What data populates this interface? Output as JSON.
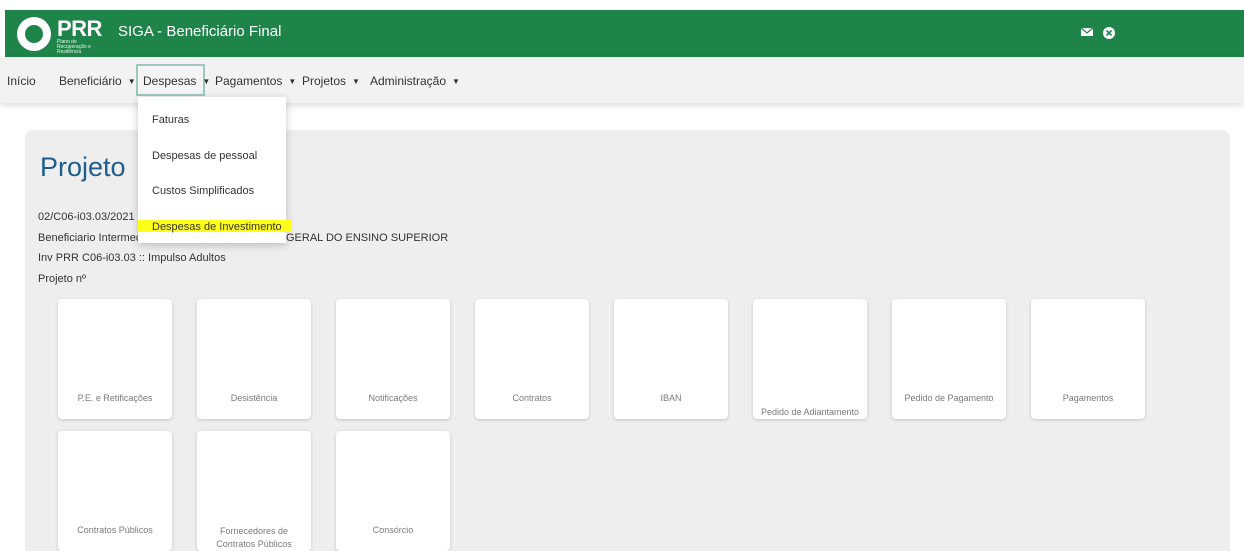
{
  "header": {
    "logo_text": "PRR",
    "logo_subtext": "Plano de Recuperação e Resiliência",
    "app_title": "SIGA - Beneficiário Final",
    "icons": [
      "mail-icon",
      "close-circle-icon"
    ],
    "brand_color": "#1e8449"
  },
  "navbar": {
    "items": [
      {
        "label": "Início",
        "has_dropdown": false
      },
      {
        "label": "Beneficiário",
        "has_dropdown": true
      },
      {
        "label": "Despesas",
        "has_dropdown": true,
        "active": true
      },
      {
        "label": "Pagamentos",
        "has_dropdown": true
      },
      {
        "label": "Projetos",
        "has_dropdown": true
      },
      {
        "label": "Administração",
        "has_dropdown": true
      }
    ],
    "caret": "▼"
  },
  "dropdown": {
    "items": [
      {
        "label": "Faturas"
      },
      {
        "label": "Despesas de pessoal"
      },
      {
        "label": "Custos Simplificados"
      },
      {
        "label": "Despesas de Investimento",
        "highlighted": true
      }
    ],
    "highlight_color": "#ffff1a"
  },
  "main": {
    "title": "Projeto",
    "info_lines": [
      "02/C06-i03.03/2021 :",
      "Beneficiario Intermec",
      "GERAL DO ENSINO SUPERIOR",
      "Inv PRR C06-i03.03 :: Impulso Adultos",
      "Projeto nº"
    ],
    "title_color": "#1f5d8c"
  },
  "cards": [
    {
      "label": "P.E. e Retificações"
    },
    {
      "label": "Desistência"
    },
    {
      "label": "Notificações"
    },
    {
      "label": "Contratos"
    },
    {
      "label": "IBAN"
    },
    {
      "label": "Pedido de Adiantamento"
    },
    {
      "label": "Pedido de Pagamento"
    },
    {
      "label": "Pagamentos"
    },
    {
      "label": "Contratos Públicos"
    },
    {
      "label": "Fornecedores de Contratos Públicos"
    },
    {
      "label": "Consórcio"
    }
  ]
}
